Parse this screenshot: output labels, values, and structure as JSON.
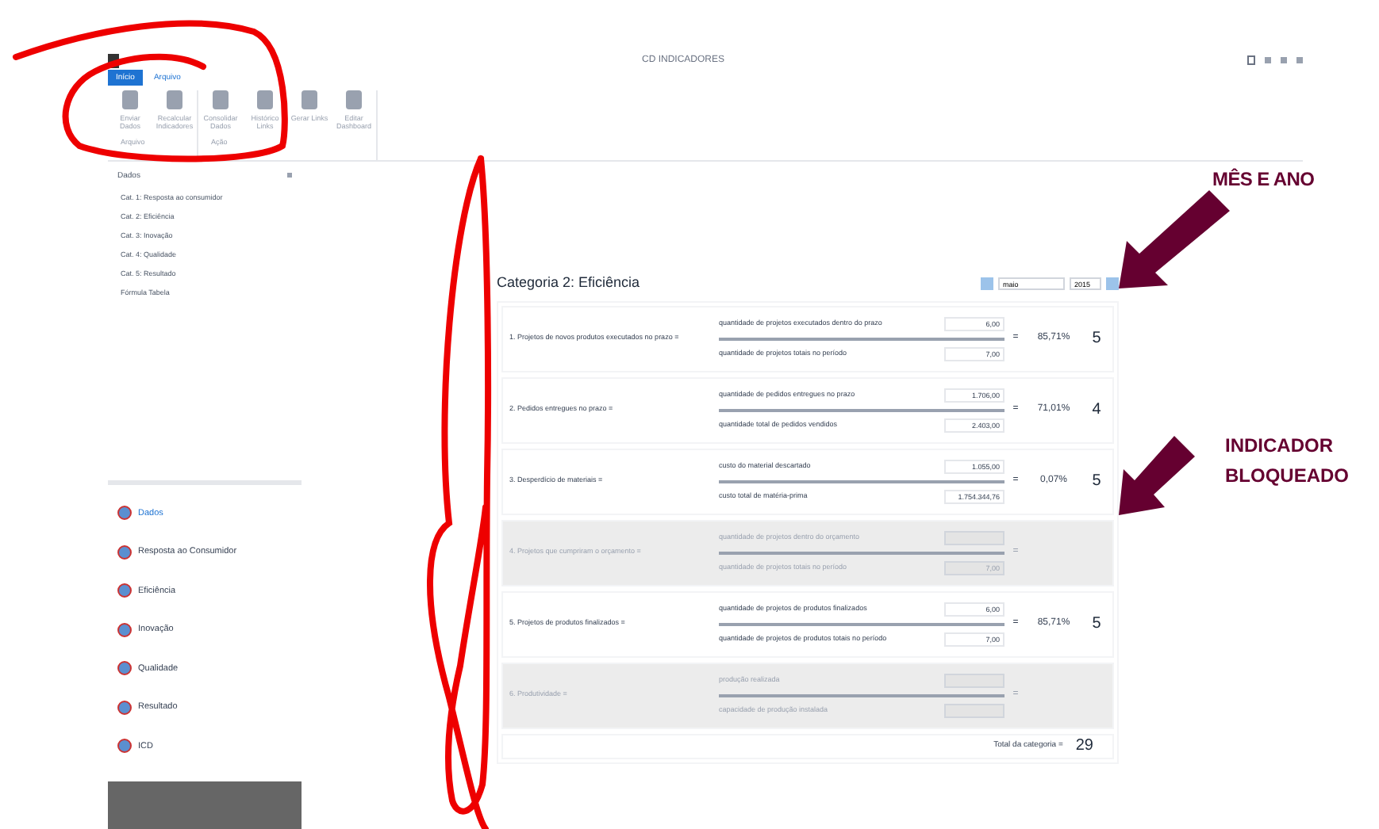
{
  "window": {
    "title": "CD INDICADORES"
  },
  "ribbon": {
    "tabs": [
      {
        "label": "Início",
        "selected": true
      },
      {
        "label": "Arquivo",
        "selected": false
      }
    ],
    "groups": [
      {
        "label": "Arquivo",
        "buttons": [
          "Enviar Dados",
          "Recalcular Indicadores"
        ]
      },
      {
        "label": "Ação",
        "buttons": [
          "Consolidar Dados",
          "Histórico Links",
          "Gerar Links",
          "Editar Dashboard"
        ]
      }
    ]
  },
  "sidebar": {
    "header": "Dados",
    "items": [
      "Cat. 1: Resposta ao consumidor",
      "Cat. 2: Eficiência",
      "Cat. 3: Inovação",
      "Cat. 4: Qualidade",
      "Cat. 5: Resultado",
      "Fórmula Tabela"
    ],
    "nav": [
      {
        "label": "Dados",
        "selected": true
      },
      {
        "label": "Resposta ao Consumidor",
        "selected": false
      },
      {
        "label": "Eficiência",
        "selected": false
      },
      {
        "label": "Inovação",
        "selected": false
      },
      {
        "label": "Qualidade",
        "selected": false
      },
      {
        "label": "Resultado",
        "selected": false
      },
      {
        "label": "ICD",
        "selected": false
      }
    ]
  },
  "category": {
    "title": "Categoria 2: Eficiência",
    "month": "maio",
    "year": "2015",
    "rows": [
      {
        "label": "1. Projetos de novos produtos executados no prazo =",
        "locked": false,
        "numerator": "quantidade de projetos executados dentro do prazo",
        "numerator_value": "6,00",
        "denominator": "quantidade de projetos totais no período",
        "denominator_value": "7,00",
        "equals": "=",
        "percent": "85,71%",
        "score": "5"
      },
      {
        "label": "2. Pedidos entregues no prazo =",
        "locked": false,
        "numerator": "quantidade de pedidos entregues no prazo",
        "numerator_value": "1.706,00",
        "denominator": "quantidade total de pedidos vendidos",
        "denominator_value": "2.403,00",
        "equals": "=",
        "percent": "71,01%",
        "score": "4"
      },
      {
        "label": "3. Desperdício de materiais =",
        "locked": false,
        "numerator": "custo do material descartado",
        "numerator_value": "1.055,00",
        "denominator": "custo total de matéria-prima",
        "denominator_value": "1.754.344,76",
        "equals": "=",
        "percent": "0,07%",
        "score": "5"
      },
      {
        "label": "4. Projetos que cumpriram o orçamento =",
        "locked": true,
        "numerator": "quantidade de projetos dentro do orçamento",
        "denominator": "quantidade de projetos totais no período",
        "denominator_value": "7,00",
        "equals": "="
      },
      {
        "label": "5. Projetos de produtos finalizados =",
        "locked": false,
        "numerator": "quantidade de projetos de produtos finalizados",
        "numerator_value": "6,00",
        "denominator": "quantidade de projetos de produtos totais no período",
        "denominator_value": "7,00",
        "equals": "=",
        "percent": "85,71%",
        "score": "5"
      },
      {
        "label": "6. Produtividade =",
        "locked": true,
        "numerator": "produção realizada",
        "denominator": "capacidade de produção instalada",
        "equals": "="
      }
    ],
    "total_label": "Total da categoria =",
    "total": "29"
  },
  "annotations": [
    "MÊS E ANO",
    "INDICADOR BLOQUEADO"
  ]
}
